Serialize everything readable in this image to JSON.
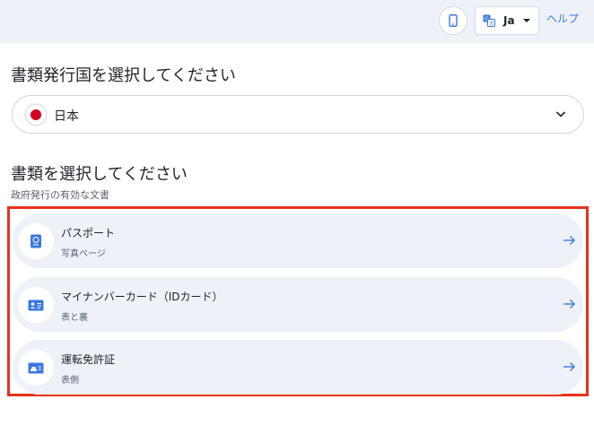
{
  "header": {
    "language_label": "Ja",
    "help_label": "ヘルプ"
  },
  "country_section": {
    "title": "書類発行国を選択してください",
    "selected_country": "日本"
  },
  "document_section": {
    "title": "書類を選択してください",
    "subtitle": "政府発行の有効な文書",
    "items": [
      {
        "title": "パスポート",
        "subtitle": "写真ページ",
        "icon": "passport-icon"
      },
      {
        "title": "マイナンバーカード（IDカード）",
        "subtitle": "表と裏",
        "icon": "id-card-icon"
      },
      {
        "title": "運転免許証",
        "subtitle": "表側",
        "icon": "drivers-license-icon"
      }
    ]
  },
  "colors": {
    "accent": "#3a78e0",
    "header_bg": "#eef2f8",
    "highlight_border": "#e8321c",
    "flag_red": "#d1001f"
  }
}
